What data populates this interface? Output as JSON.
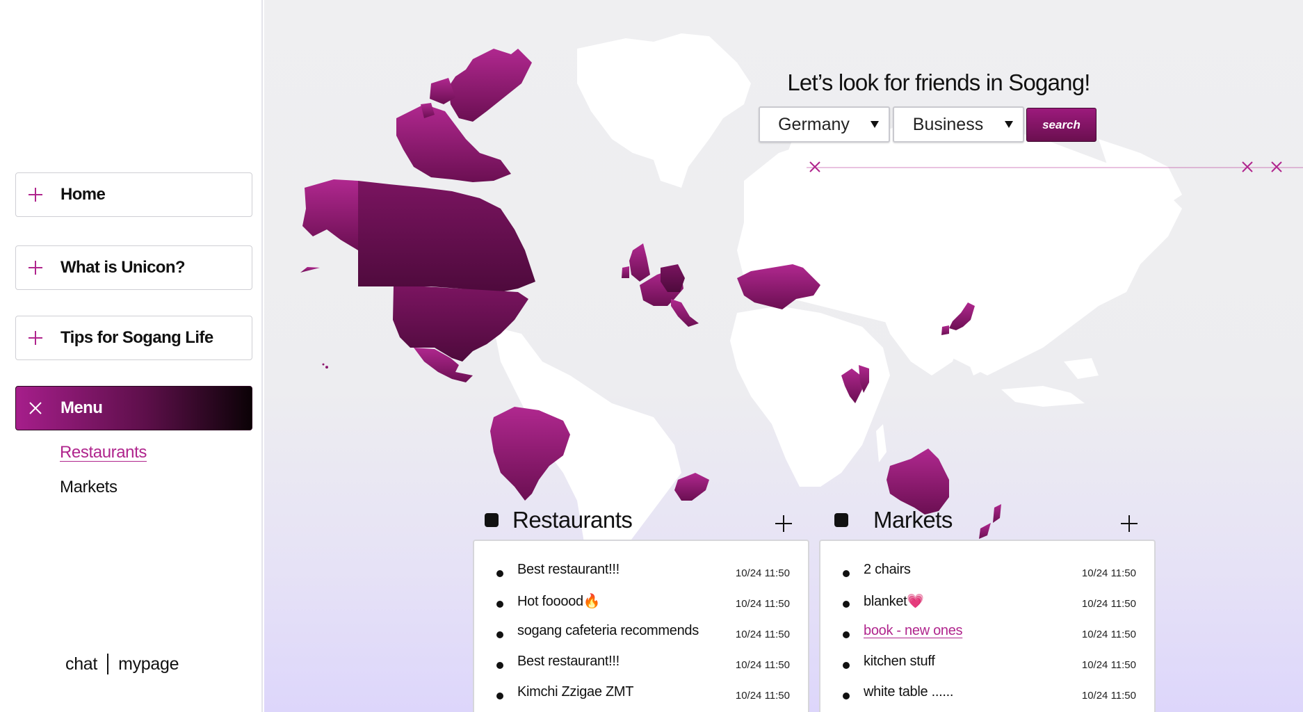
{
  "sidebar": {
    "nav": [
      {
        "label": "Home",
        "icon": "plus-icon"
      },
      {
        "label": "What is Unicon?",
        "icon": "plus-icon"
      },
      {
        "label": "Tips for Sogang Life",
        "icon": "plus-icon"
      },
      {
        "label": "Menu",
        "icon": "close-icon"
      }
    ],
    "submenu": [
      "Restaurants",
      "Markets"
    ],
    "footer": {
      "chat": "chat",
      "mypage": "mypage"
    }
  },
  "main": {
    "headline": "Let’s look for friends in Sogang!",
    "country_select": {
      "value": "Germany"
    },
    "category_select": {
      "value": "Business"
    },
    "search_label": "search"
  },
  "restaurants": {
    "title": "Restaurants",
    "items": [
      {
        "title": "Best restaurant!!!",
        "time": "10/24  11:50"
      },
      {
        "title": "Hot fooood🔥",
        "time": "10/24  11:50"
      },
      {
        "title": "sogang cafeteria recommends",
        "time": "10/24  11:50"
      },
      {
        "title": "Best restaurant!!!",
        "time": "10/24  11:50"
      },
      {
        "title": "Kimchi Zzigae ZMT",
        "time": "10/24  11:50"
      }
    ]
  },
  "markets": {
    "title": "Markets",
    "items": [
      {
        "title": "2 chairs",
        "time": "10/24  11:50"
      },
      {
        "title": "blanket💗",
        "time": "10/24  11:50"
      },
      {
        "title": "book - new ones",
        "time": "10/24  11:50"
      },
      {
        "title": "kitchen stuff",
        "time": "10/24  11:50"
      },
      {
        "title": "white table ......",
        "time": "10/24  11:50"
      }
    ]
  },
  "colors": {
    "accent": "#b0258d",
    "accent_dark": "#5d0f4a",
    "map_land": "#ffffff",
    "map_highlight": "#a61e8b"
  },
  "highlighted_regions": [
    "Alaska",
    "Canada",
    "Greenland",
    "United States",
    "Mexico",
    "Brazil",
    "United Kingdom",
    "Germany",
    "France",
    "Italy",
    "Kazakhstan",
    "Japan",
    "Vietnam",
    "Thailand",
    "South Africa",
    "Australia",
    "New Zealand"
  ]
}
